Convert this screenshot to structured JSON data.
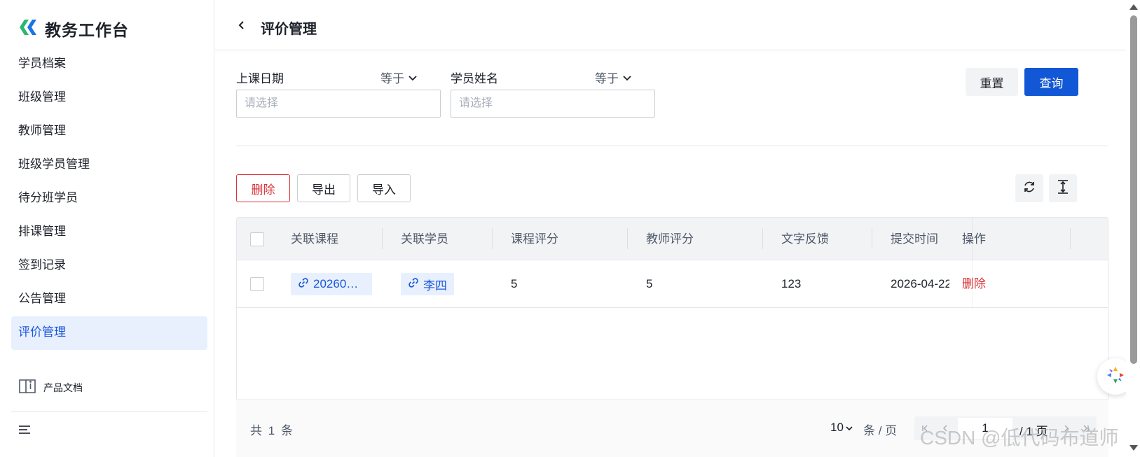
{
  "app": {
    "title": "教务工作台"
  },
  "sidebar": {
    "items": [
      {
        "label": "学员档案"
      },
      {
        "label": "班级管理"
      },
      {
        "label": "教师管理"
      },
      {
        "label": "班级学员管理"
      },
      {
        "label": "待分班学员"
      },
      {
        "label": "排课管理"
      },
      {
        "label": "签到记录"
      },
      {
        "label": "公告管理"
      },
      {
        "label": "评价管理",
        "active": true
      }
    ],
    "doc_label": "产品文档"
  },
  "header": {
    "title": "评价管理"
  },
  "filters": [
    {
      "label": "上课日期",
      "operator": "等于",
      "placeholder": "请选择"
    },
    {
      "label": "学员姓名",
      "operator": "等于",
      "placeholder": "请选择"
    }
  ],
  "actions": {
    "reset_label": "重置",
    "query_label": "查询"
  },
  "toolbar": {
    "delete_label": "删除",
    "export_label": "导出",
    "import_label": "导入"
  },
  "table": {
    "columns": [
      "关联课程",
      "关联学员",
      "课程评分",
      "教师评分",
      "文字反馈",
      "提交时间",
      "操作"
    ],
    "rows": [
      {
        "course": "20260…",
        "student": "李四",
        "course_score": "5",
        "teacher_score": "5",
        "feedback": "123",
        "submit_time": "2026-04-22",
        "op": "删除"
      }
    ]
  },
  "pagination": {
    "total_prefix": "共",
    "total": "1",
    "total_suffix": "条",
    "page_size": "10",
    "per_page_label": "条 / 页",
    "current_page": "1",
    "total_pages_label": "/ 1 页"
  },
  "watermark": "CSDN @低代码布道师",
  "colors": {
    "primary": "#1257d6",
    "danger": "#d9343b",
    "active_bg": "#e8f0fe"
  }
}
